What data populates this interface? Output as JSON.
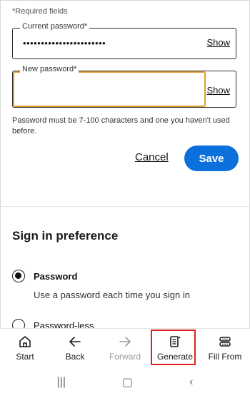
{
  "form": {
    "required_note": "*Required fields",
    "current_label": "Current password*",
    "current_value": "•••••••••••••••••••••••",
    "current_show": "Show",
    "new_label": "New password*",
    "new_show": "Show",
    "helper": "Password must be 7-100 characters and one you haven't used before.",
    "cancel_label": "Cancel",
    "save_label": "Save"
  },
  "preference": {
    "title": "Sign in preference",
    "options": [
      {
        "label": "Password",
        "description": "Use a password each time you sign in",
        "selected": true
      },
      {
        "label": "Password-less",
        "selected": false
      }
    ]
  },
  "toolbar": {
    "items": [
      {
        "label": "Start",
        "icon": "home-icon",
        "enabled": true
      },
      {
        "label": "Back",
        "icon": "arrow-left-icon",
        "enabled": true
      },
      {
        "label": "Forward",
        "icon": "arrow-right-icon",
        "enabled": false
      },
      {
        "label": "Generate",
        "icon": "generate-password-icon",
        "enabled": true,
        "highlighted": true
      },
      {
        "label": "Fill From",
        "icon": "fill-from-icon",
        "enabled": true
      }
    ]
  },
  "navbar": {
    "recent": "|||",
    "home": "▢",
    "back": "‹"
  },
  "colors": {
    "accent": "#0b6fdc",
    "focus": "#e0a02f",
    "highlight": "#e02020"
  }
}
